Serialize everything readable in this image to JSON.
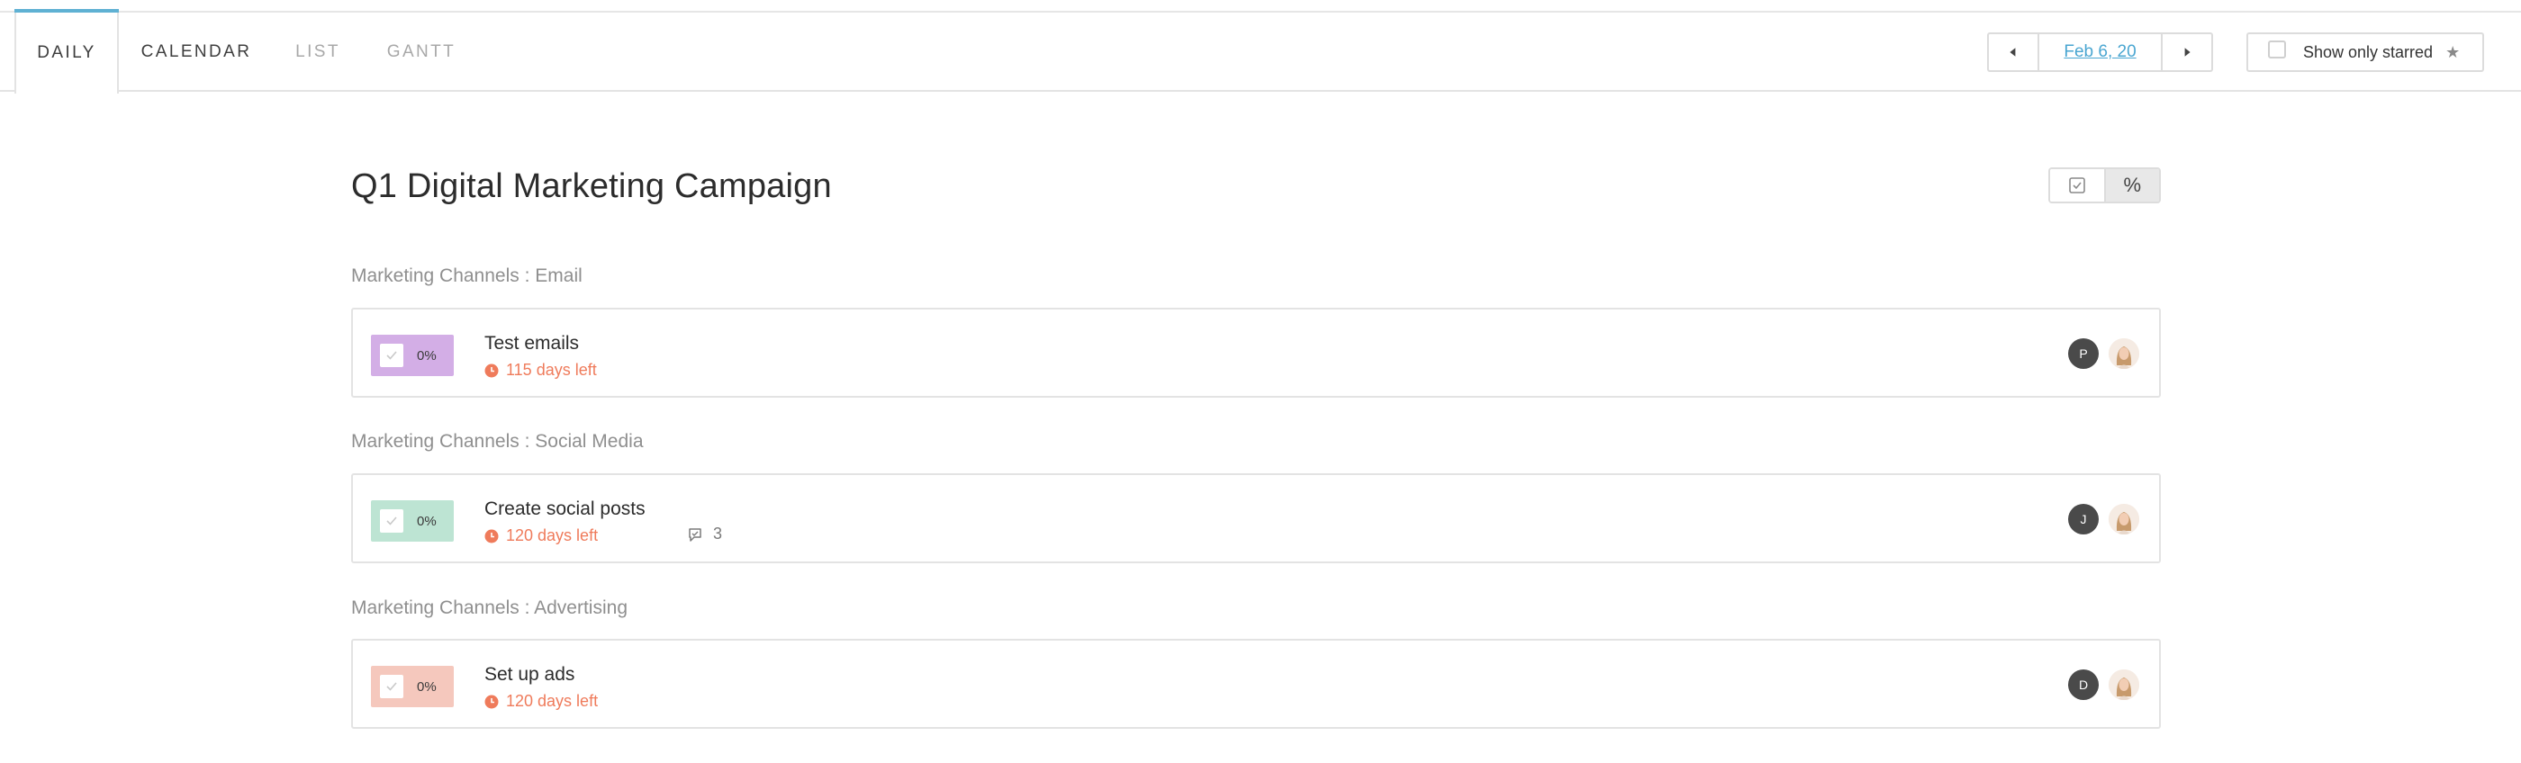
{
  "tabs": [
    {
      "label": "DAILY",
      "active": true
    },
    {
      "label": "CALENDAR",
      "active": false
    },
    {
      "label": "LIST",
      "active": false
    },
    {
      "label": "GANTT",
      "active": false
    }
  ],
  "date_nav": {
    "date": "Feb 6, 20",
    "prev_icon": "caret-left-icon",
    "next_icon": "caret-right-icon"
  },
  "starred_filter": {
    "label": "Show only starred",
    "checked": false,
    "icon": "star-icon"
  },
  "project": {
    "title": "Q1 Digital Marketing Campaign"
  },
  "view_toggle": {
    "options": [
      "checkbox-icon",
      "%"
    ],
    "selected": "%"
  },
  "sections": [
    {
      "label": "Marketing Channels : Email",
      "task": {
        "name": "Test emails",
        "progress": "0%",
        "progress_color": "#d3aee6",
        "due": "115 days left",
        "comments": null,
        "assignee_initial": "P"
      }
    },
    {
      "label": "Marketing Channels : Social Media",
      "task": {
        "name": "Create social posts",
        "progress": "0%",
        "progress_color": "#bde4d3",
        "due": "120 days left",
        "comments": "3",
        "assignee_initial": "J"
      }
    },
    {
      "label": "Marketing Channels : Advertising",
      "task": {
        "name": "Set up ads",
        "progress": "0%",
        "progress_color": "#f5c8bd",
        "due": "120 days left",
        "comments": null,
        "assignee_initial": "D"
      }
    }
  ],
  "colors": {
    "accent": "#5fb1d3",
    "due": "#ef7b5b",
    "link": "#4aa6d1"
  }
}
